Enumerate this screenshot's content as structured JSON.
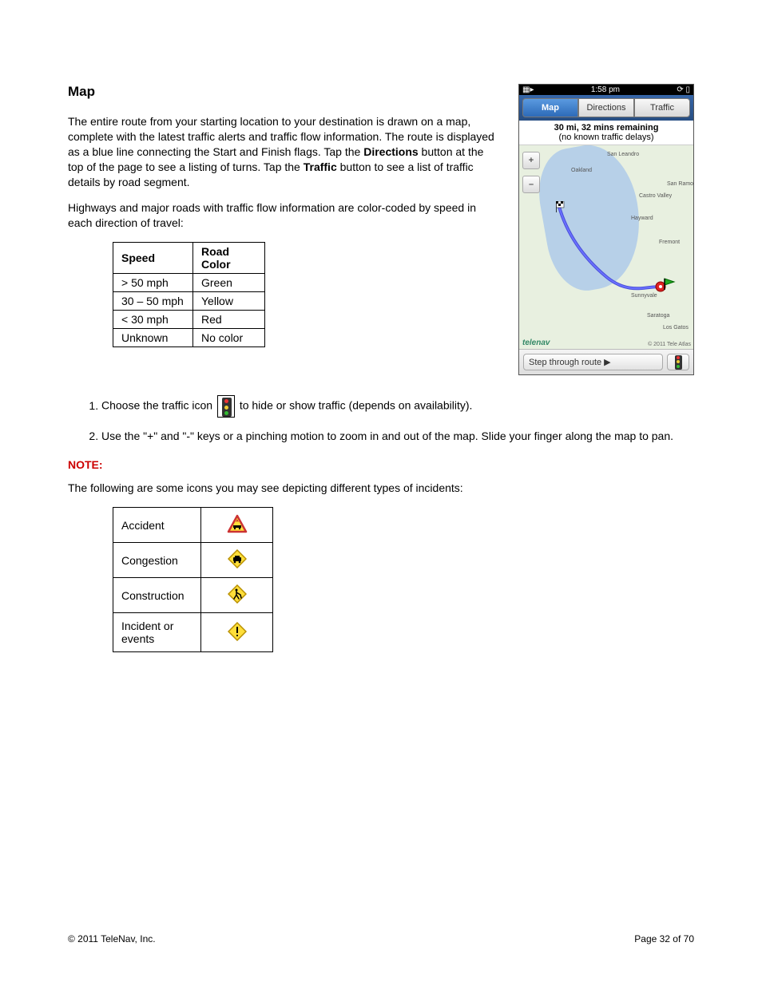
{
  "heading": "Map",
  "para1_a": "The entire route from your starting location to your destination is drawn on a map, complete with the latest traffic alerts and traffic flow information. The route is displayed as a blue line connecting the Start and Finish flags. Tap the ",
  "para1_b1": "Directions",
  "para1_c": " button at the top of the page to see a listing of turns. Tap the ",
  "para1_b2": "Traffic",
  "para1_d": " button to see a list of traffic details by road segment.",
  "para2": "Highways and major roads with traffic flow information are color-coded by speed in each direction of travel:",
  "speed_table": {
    "head": [
      "Speed",
      "Road Color"
    ],
    "rows": [
      [
        "> 50 mph",
        "Green"
      ],
      [
        "30 – 50 mph",
        "Yellow"
      ],
      [
        "< 30 mph",
        "Red"
      ],
      [
        "Unknown",
        "No color"
      ]
    ]
  },
  "phone": {
    "time": "1:58 pm",
    "tabs": [
      "Map",
      "Directions",
      "Traffic"
    ],
    "info1": "30 mi, 32 mins remaining",
    "info2": "(no known traffic delays)",
    "zoom_in": "+",
    "zoom_out": "–",
    "step": "Step through route  ▶",
    "brand": "telenav",
    "copyright": "© 2011 Tele Atlas",
    "labels": [
      "San Leandro",
      "Oakland",
      "Hayward",
      "Fremont",
      "San Ramon",
      "Sunnyvale",
      "Saratoga",
      "Los Gatos",
      "Castro Valley"
    ]
  },
  "step1_a": "Choose the traffic icon ",
  "step1_b": " to hide or show traffic (depends on availability).",
  "step2": "Use the \"+\" and \"-\" keys or a pinching motion to zoom in and out of the map. Slide your finger along the map to pan.",
  "note_label": "NOTE:",
  "note_text": "The following are some icons you may see depicting different types of incidents:",
  "incidents": [
    {
      "label": "Accident",
      "icon": "accident"
    },
    {
      "label": "Congestion",
      "icon": "congestion"
    },
    {
      "label": "Construction",
      "icon": "construction"
    },
    {
      "label": "Incident or events",
      "icon": "incident"
    }
  ],
  "footer_left": "© 2011 TeleNav, Inc.",
  "footer_right": "Page 32 of 70"
}
